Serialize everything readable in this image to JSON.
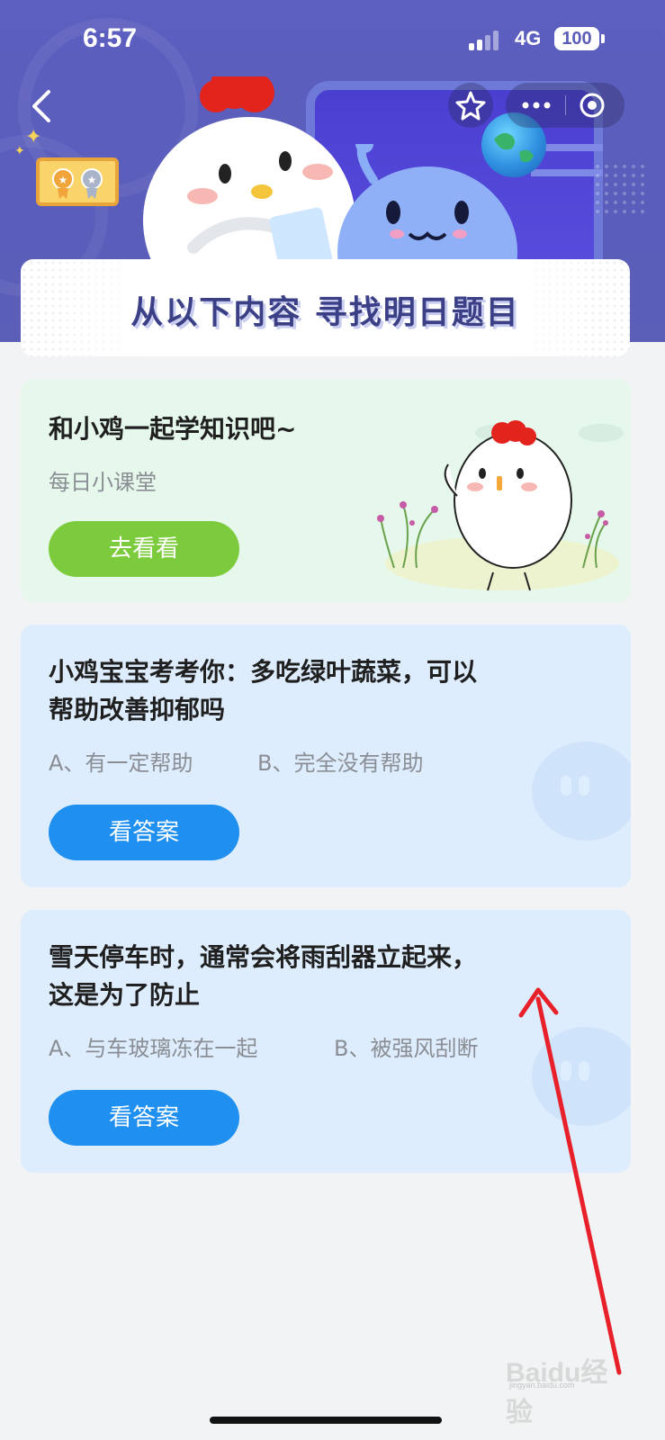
{
  "status_bar": {
    "time": "6:57",
    "network": "4G",
    "battery": "100"
  },
  "header": {
    "banner_title": "从以下内容  寻找明日题目"
  },
  "cards": [
    {
      "title": "和小鸡一起学知识吧~",
      "subtitle": "每日小课堂",
      "button": "去看看"
    },
    {
      "question_line1": "小鸡宝宝考考你：多吃绿叶蔬菜，可以",
      "question_line2": "帮助改善抑郁吗",
      "option_a": "A、有一定帮助",
      "option_b": "B、完全没有帮助",
      "button": "看答案"
    },
    {
      "question_line1": "雪天停车时，通常会将雨刮器立起来，",
      "question_line2": "这是为了防止",
      "option_a": "A、与车玻璃冻在一起",
      "option_b": "B、被强风刮断",
      "button": "看答案"
    }
  ],
  "watermark": {
    "text": "Baidu经验",
    "url_text": "jingyan.baidu.com"
  },
  "colors": {
    "header": "#5a5db9",
    "green_button": "#7ccb3c",
    "blue_button": "#1f8ff0",
    "annotation_arrow": "#e8202a"
  },
  "icons": [
    "back-icon",
    "star-icon",
    "more-icon",
    "close-circle-icon"
  ]
}
